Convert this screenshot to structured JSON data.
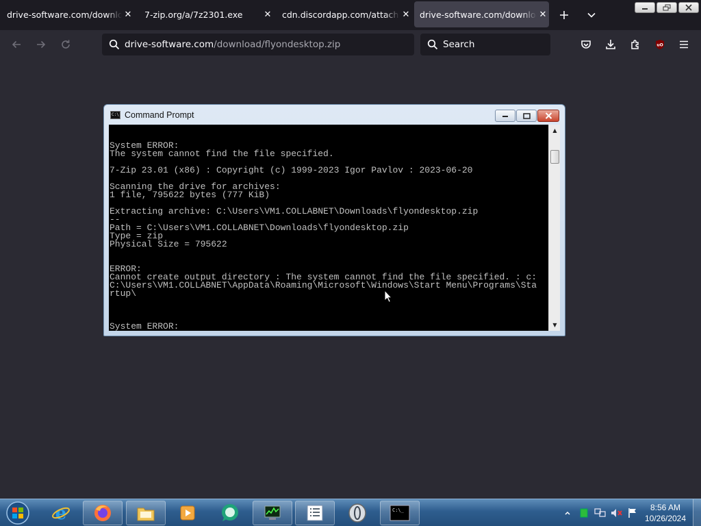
{
  "browser": {
    "tabs": [
      {
        "title": "drive-software.com/download/flyondesktop.zip",
        "active": false
      },
      {
        "title": "7-zip.org/a/7z2301.exe",
        "active": false
      },
      {
        "title": "cdn.discordapp.com/attachments",
        "active": false
      },
      {
        "title": "drive-software.com/download/flyondesktop.zip",
        "active": true
      }
    ],
    "close_glyph": "✕",
    "url_host": "drive-software.com",
    "url_path": "/download/flyondesktop.zip",
    "search_placeholder": "Search"
  },
  "cmd": {
    "title": "Command Prompt",
    "icon_text": "C:\\",
    "lines": [
      "System ERROR:",
      "The system cannot find the file specified.",
      "",
      "7-Zip 23.01 (x86) : Copyright (c) 1999-2023 Igor Pavlov : 2023-06-20",
      "",
      "Scanning the drive for archives:",
      "1 file, 795622 bytes (777 KiB)",
      "",
      "Extracting archive: C:\\Users\\VM1.COLLABNET\\Downloads\\flyondesktop.zip",
      "--",
      "Path = C:\\Users\\VM1.COLLABNET\\Downloads\\flyondesktop.zip",
      "Type = zip",
      "Physical Size = 795622",
      "",
      "",
      "ERROR:",
      "Cannot create output directory : The system cannot find the file specified. : c:",
      "C:\\Users\\VM1.COLLABNET\\AppData\\Roaming\\Microsoft\\Windows\\Start Menu\\Programs\\Sta",
      "rtup\\",
      "",
      "",
      "",
      "System ERROR:"
    ]
  },
  "taskbar": {
    "items": [
      "start-orb",
      "internet-explorer",
      "firefox",
      "file-explorer",
      "media-player",
      "chat-app",
      "task-manager",
      "notepad",
      "opera",
      "command-prompt"
    ],
    "time": "8:56 AM",
    "date": "10/26/2024"
  }
}
